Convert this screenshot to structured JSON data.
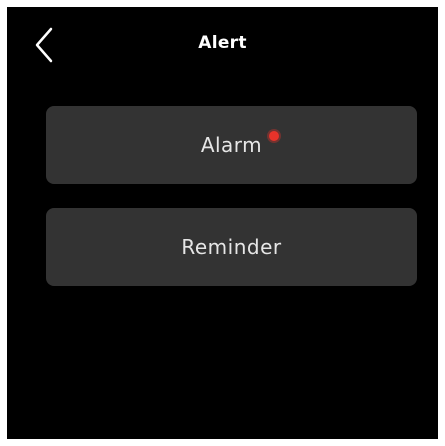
{
  "header": {
    "title": "Alert",
    "back_icon": "chevron-left-icon"
  },
  "menu": {
    "items": [
      {
        "label": "Alarm",
        "has_notification_dot": true
      },
      {
        "label": "Reminder",
        "has_notification_dot": false
      }
    ]
  },
  "colors": {
    "background": "#000000",
    "button_background": "#333333",
    "text": "#ffffff",
    "notification_dot": "#e8332a"
  }
}
